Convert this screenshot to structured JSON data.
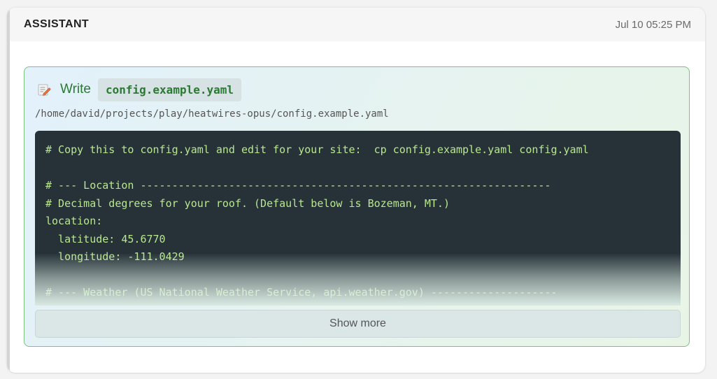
{
  "message": {
    "role": "ASSISTANT",
    "timestamp": "Jul 10 05:25 PM"
  },
  "tool": {
    "icon": "memo-icon",
    "name": "Write",
    "file_name": "config.example.yaml",
    "file_path": "/home/david/projects/play/heatwires-opus/config.example.yaml",
    "code_lines": [
      "# Copy this to config.yaml and edit for your site:  cp config.example.yaml config.yaml",
      "",
      "# --- Location -----------------------------------------------------------------",
      "# Decimal degrees for your roof. (Default below is Bozeman, MT.)",
      "location:",
      "  latitude: 45.6770",
      "  longitude: -111.0429",
      "",
      "# --- Weather (US National Weather Service, api.weather.gov) --------------------"
    ],
    "show_more_label": "Show more"
  },
  "colors": {
    "accent_green": "#2a7a32",
    "border_green": "#7cc17e",
    "code_background": "#263238",
    "code_text": "#b9e78f"
  }
}
